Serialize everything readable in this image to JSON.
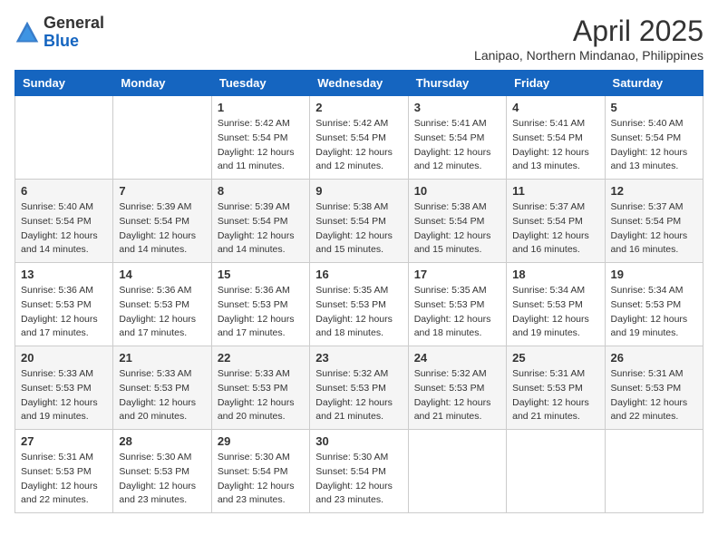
{
  "header": {
    "logo_general": "General",
    "logo_blue": "Blue",
    "month_year": "April 2025",
    "location": "Lanipao, Northern Mindanao, Philippines"
  },
  "days_of_week": [
    "Sunday",
    "Monday",
    "Tuesday",
    "Wednesday",
    "Thursday",
    "Friday",
    "Saturday"
  ],
  "weeks": [
    [
      {
        "day": "",
        "info": ""
      },
      {
        "day": "",
        "info": ""
      },
      {
        "day": "1",
        "info": "Sunrise: 5:42 AM\nSunset: 5:54 PM\nDaylight: 12 hours\nand 11 minutes."
      },
      {
        "day": "2",
        "info": "Sunrise: 5:42 AM\nSunset: 5:54 PM\nDaylight: 12 hours\nand 12 minutes."
      },
      {
        "day": "3",
        "info": "Sunrise: 5:41 AM\nSunset: 5:54 PM\nDaylight: 12 hours\nand 12 minutes."
      },
      {
        "day": "4",
        "info": "Sunrise: 5:41 AM\nSunset: 5:54 PM\nDaylight: 12 hours\nand 13 minutes."
      },
      {
        "day": "5",
        "info": "Sunrise: 5:40 AM\nSunset: 5:54 PM\nDaylight: 12 hours\nand 13 minutes."
      }
    ],
    [
      {
        "day": "6",
        "info": "Sunrise: 5:40 AM\nSunset: 5:54 PM\nDaylight: 12 hours\nand 14 minutes."
      },
      {
        "day": "7",
        "info": "Sunrise: 5:39 AM\nSunset: 5:54 PM\nDaylight: 12 hours\nand 14 minutes."
      },
      {
        "day": "8",
        "info": "Sunrise: 5:39 AM\nSunset: 5:54 PM\nDaylight: 12 hours\nand 14 minutes."
      },
      {
        "day": "9",
        "info": "Sunrise: 5:38 AM\nSunset: 5:54 PM\nDaylight: 12 hours\nand 15 minutes."
      },
      {
        "day": "10",
        "info": "Sunrise: 5:38 AM\nSunset: 5:54 PM\nDaylight: 12 hours\nand 15 minutes."
      },
      {
        "day": "11",
        "info": "Sunrise: 5:37 AM\nSunset: 5:54 PM\nDaylight: 12 hours\nand 16 minutes."
      },
      {
        "day": "12",
        "info": "Sunrise: 5:37 AM\nSunset: 5:54 PM\nDaylight: 12 hours\nand 16 minutes."
      }
    ],
    [
      {
        "day": "13",
        "info": "Sunrise: 5:36 AM\nSunset: 5:53 PM\nDaylight: 12 hours\nand 17 minutes."
      },
      {
        "day": "14",
        "info": "Sunrise: 5:36 AM\nSunset: 5:53 PM\nDaylight: 12 hours\nand 17 minutes."
      },
      {
        "day": "15",
        "info": "Sunrise: 5:36 AM\nSunset: 5:53 PM\nDaylight: 12 hours\nand 17 minutes."
      },
      {
        "day": "16",
        "info": "Sunrise: 5:35 AM\nSunset: 5:53 PM\nDaylight: 12 hours\nand 18 minutes."
      },
      {
        "day": "17",
        "info": "Sunrise: 5:35 AM\nSunset: 5:53 PM\nDaylight: 12 hours\nand 18 minutes."
      },
      {
        "day": "18",
        "info": "Sunrise: 5:34 AM\nSunset: 5:53 PM\nDaylight: 12 hours\nand 19 minutes."
      },
      {
        "day": "19",
        "info": "Sunrise: 5:34 AM\nSunset: 5:53 PM\nDaylight: 12 hours\nand 19 minutes."
      }
    ],
    [
      {
        "day": "20",
        "info": "Sunrise: 5:33 AM\nSunset: 5:53 PM\nDaylight: 12 hours\nand 19 minutes."
      },
      {
        "day": "21",
        "info": "Sunrise: 5:33 AM\nSunset: 5:53 PM\nDaylight: 12 hours\nand 20 minutes."
      },
      {
        "day": "22",
        "info": "Sunrise: 5:33 AM\nSunset: 5:53 PM\nDaylight: 12 hours\nand 20 minutes."
      },
      {
        "day": "23",
        "info": "Sunrise: 5:32 AM\nSunset: 5:53 PM\nDaylight: 12 hours\nand 21 minutes."
      },
      {
        "day": "24",
        "info": "Sunrise: 5:32 AM\nSunset: 5:53 PM\nDaylight: 12 hours\nand 21 minutes."
      },
      {
        "day": "25",
        "info": "Sunrise: 5:31 AM\nSunset: 5:53 PM\nDaylight: 12 hours\nand 21 minutes."
      },
      {
        "day": "26",
        "info": "Sunrise: 5:31 AM\nSunset: 5:53 PM\nDaylight: 12 hours\nand 22 minutes."
      }
    ],
    [
      {
        "day": "27",
        "info": "Sunrise: 5:31 AM\nSunset: 5:53 PM\nDaylight: 12 hours\nand 22 minutes."
      },
      {
        "day": "28",
        "info": "Sunrise: 5:30 AM\nSunset: 5:53 PM\nDaylight: 12 hours\nand 23 minutes."
      },
      {
        "day": "29",
        "info": "Sunrise: 5:30 AM\nSunset: 5:54 PM\nDaylight: 12 hours\nand 23 minutes."
      },
      {
        "day": "30",
        "info": "Sunrise: 5:30 AM\nSunset: 5:54 PM\nDaylight: 12 hours\nand 23 minutes."
      },
      {
        "day": "",
        "info": ""
      },
      {
        "day": "",
        "info": ""
      },
      {
        "day": "",
        "info": ""
      }
    ]
  ]
}
